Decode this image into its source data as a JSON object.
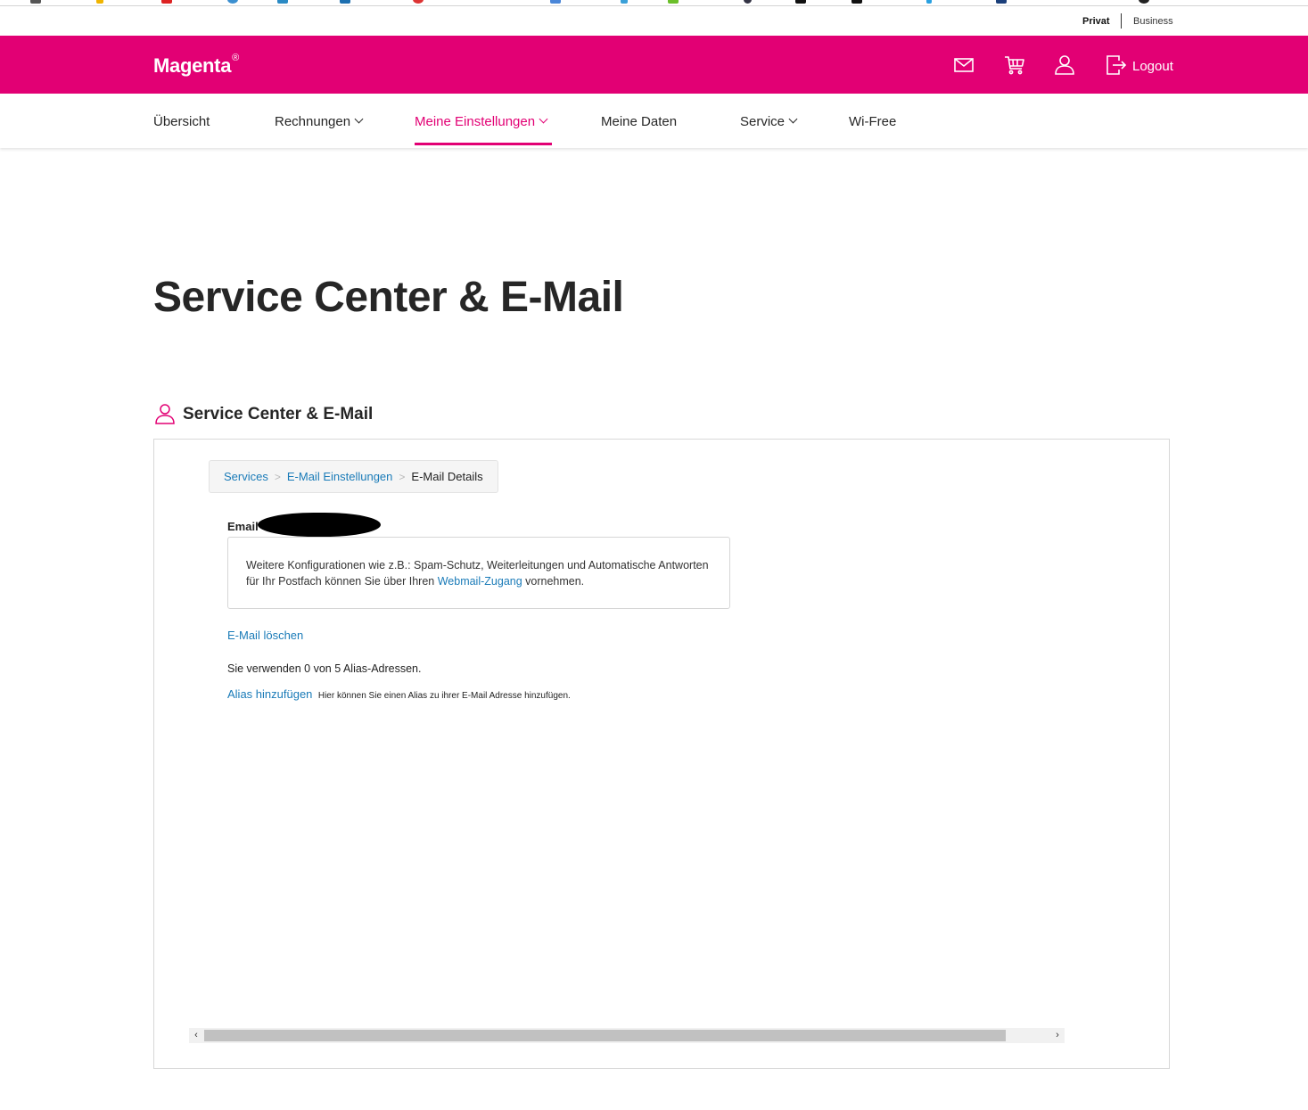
{
  "segments": {
    "privat": "Privat",
    "business": "Business"
  },
  "header": {
    "logo": "Magenta",
    "logo_mark": "®",
    "logout": "Logout",
    "brand_color": "#e20074",
    "icons": [
      "mail-icon",
      "cart-icon",
      "user-icon",
      "logout-icon"
    ]
  },
  "nav": {
    "items": [
      {
        "label": "Übersicht",
        "dropdown": false,
        "active": false
      },
      {
        "label": "Rechnungen",
        "dropdown": true,
        "active": false
      },
      {
        "label": "Meine Einstellungen",
        "dropdown": true,
        "active": true
      },
      {
        "label": "Meine Daten",
        "dropdown": false,
        "active": false
      },
      {
        "label": "Service",
        "dropdown": true,
        "active": false
      },
      {
        "label": "Wi-Free",
        "dropdown": false,
        "active": false
      }
    ]
  },
  "page": {
    "title": "Service Center & E-Mail"
  },
  "section": {
    "title": "Service Center & E-Mail",
    "icon": "user-icon"
  },
  "breadcrumb": {
    "items": [
      "Services",
      "E-Mail Einstellungen",
      "E-Mail Details"
    ],
    "separator": ">"
  },
  "details": {
    "email_label": "Email",
    "info_text_before": "Weitere Konfigurationen wie z.B.: Spam-Schutz, Weiterleitungen und Automatische Antworten für Ihr Postfach können Sie über Ihren ",
    "info_link": "Webmail-Zugang",
    "info_text_after": " vornehmen.",
    "delete_link": "E-Mail löschen",
    "alias_count": "Sie verwenden 0 von 5 Alias-Adressen.",
    "alias_link": "Alias hinzufügen",
    "alias_hint": "Hier können Sie einen Alias zu ihrer E-Mail Adresse hinzufügen."
  },
  "scrollbar": {
    "left_arrow": "‹",
    "right_arrow": "›"
  }
}
